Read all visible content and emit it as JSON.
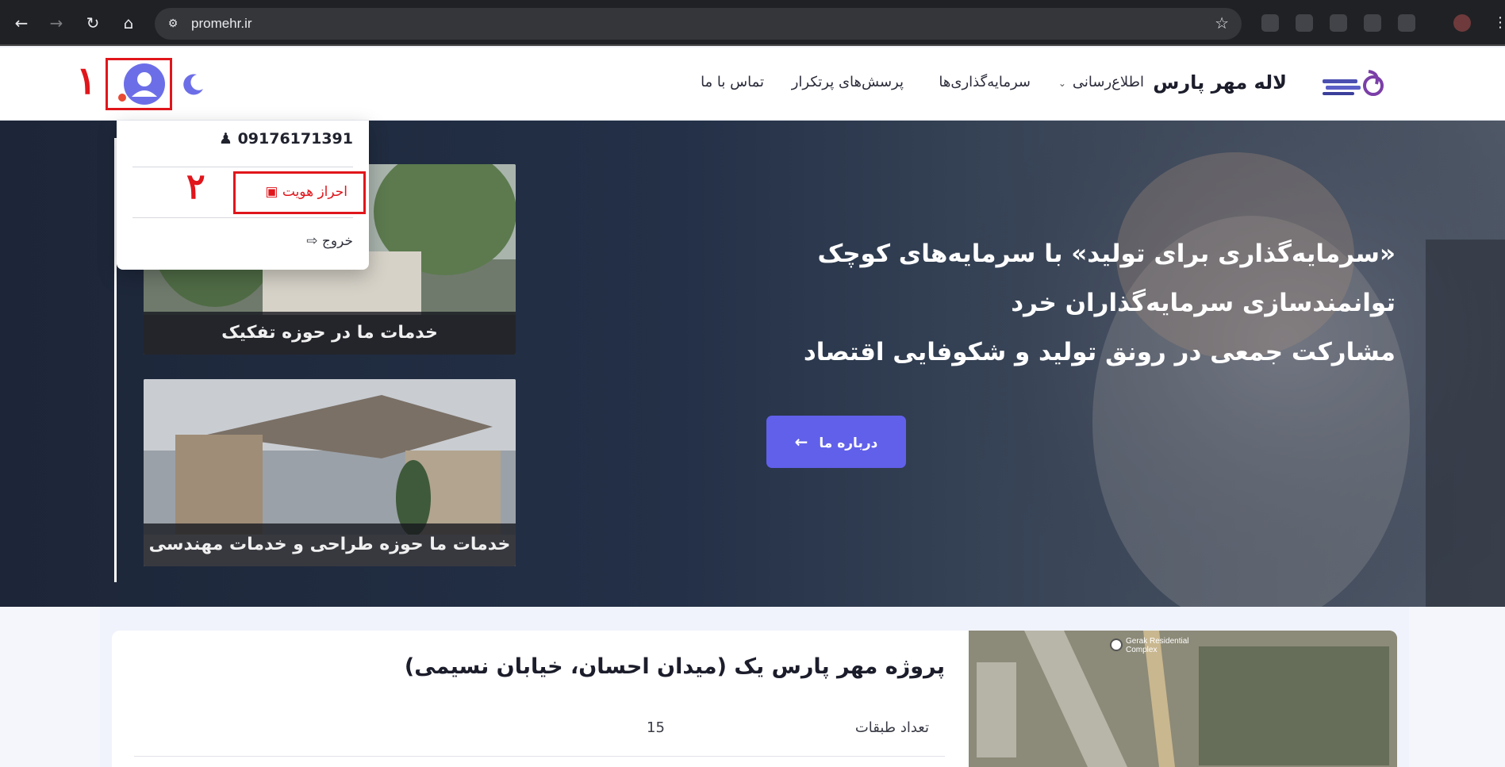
{
  "browser": {
    "url": "promehr.ir",
    "back_icon": "arrow-left-icon",
    "forward_icon": "arrow-right-icon",
    "reload_icon": "reload-icon",
    "home_icon": "home-icon",
    "bookmark_icon": "star-icon"
  },
  "header": {
    "brand": "لاله مهر پارس",
    "nav": [
      {
        "label": "اطلاع‌رسانی",
        "has_dropdown": true
      },
      {
        "label": "سرمایه‌گذاری‌ها"
      },
      {
        "label": "پرسش‌های پرتکرار"
      },
      {
        "label": "تماس با ما"
      }
    ],
    "theme_icon": "moon-icon",
    "avatar_icon": "user-avatar-icon"
  },
  "annotations": {
    "step1": "۱",
    "step2": "۲",
    "highlight_color": "#e0161b"
  },
  "user_menu": {
    "phone": "09176171391",
    "kyc_label": "احراز هویت",
    "logout_label": "خروج"
  },
  "hero": {
    "lines": [
      "«سرمایه‌گذاری برای تولید» با سرمایه‌های کوچک",
      "توانمندسازی سرمایه‌گذاران خرد",
      "مشارکت جمعی در رونق تولید و شکوفایی اقتصاد"
    ],
    "about_button": "درباره ما",
    "cards": [
      {
        "caption": "خدمات ما در حوزه تفکیک"
      },
      {
        "caption": "خدمات ما حوزه طراحی و خدمات مهندسی"
      }
    ],
    "accent_color": "#6160ea"
  },
  "project": {
    "title": "پروژه مهر پارس یک (میدان احسان، خیابان نسیمی)",
    "floors_label": "تعداد طبقات",
    "floors_value": "15",
    "map_label": "Gerak Residential Complex"
  }
}
